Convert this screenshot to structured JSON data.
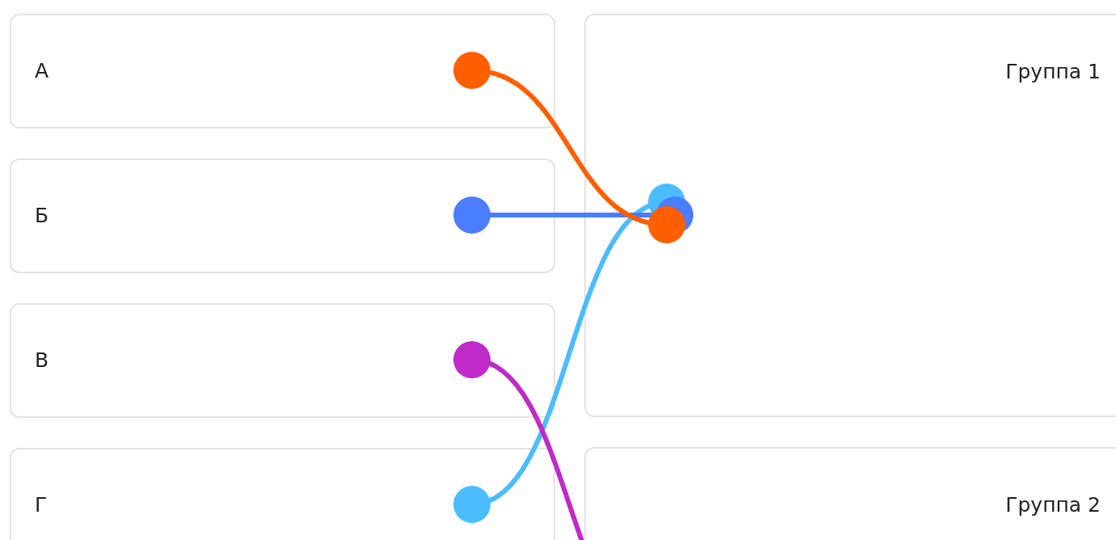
{
  "items": [
    {
      "label": "А",
      "color": "#ff5f00",
      "kind": "upper"
    },
    {
      "label": "Б",
      "color": "#4a7dff",
      "kind": "upper"
    },
    {
      "label": "В",
      "color": "#c02ac8",
      "kind": "lower"
    },
    {
      "label": "Г",
      "color": "#4bbdff",
      "kind": "upper"
    }
  ],
  "groups": [
    {
      "label": "Группа 1",
      "kind": "tall"
    },
    {
      "label": "Группа 2",
      "kind": "short"
    }
  ]
}
